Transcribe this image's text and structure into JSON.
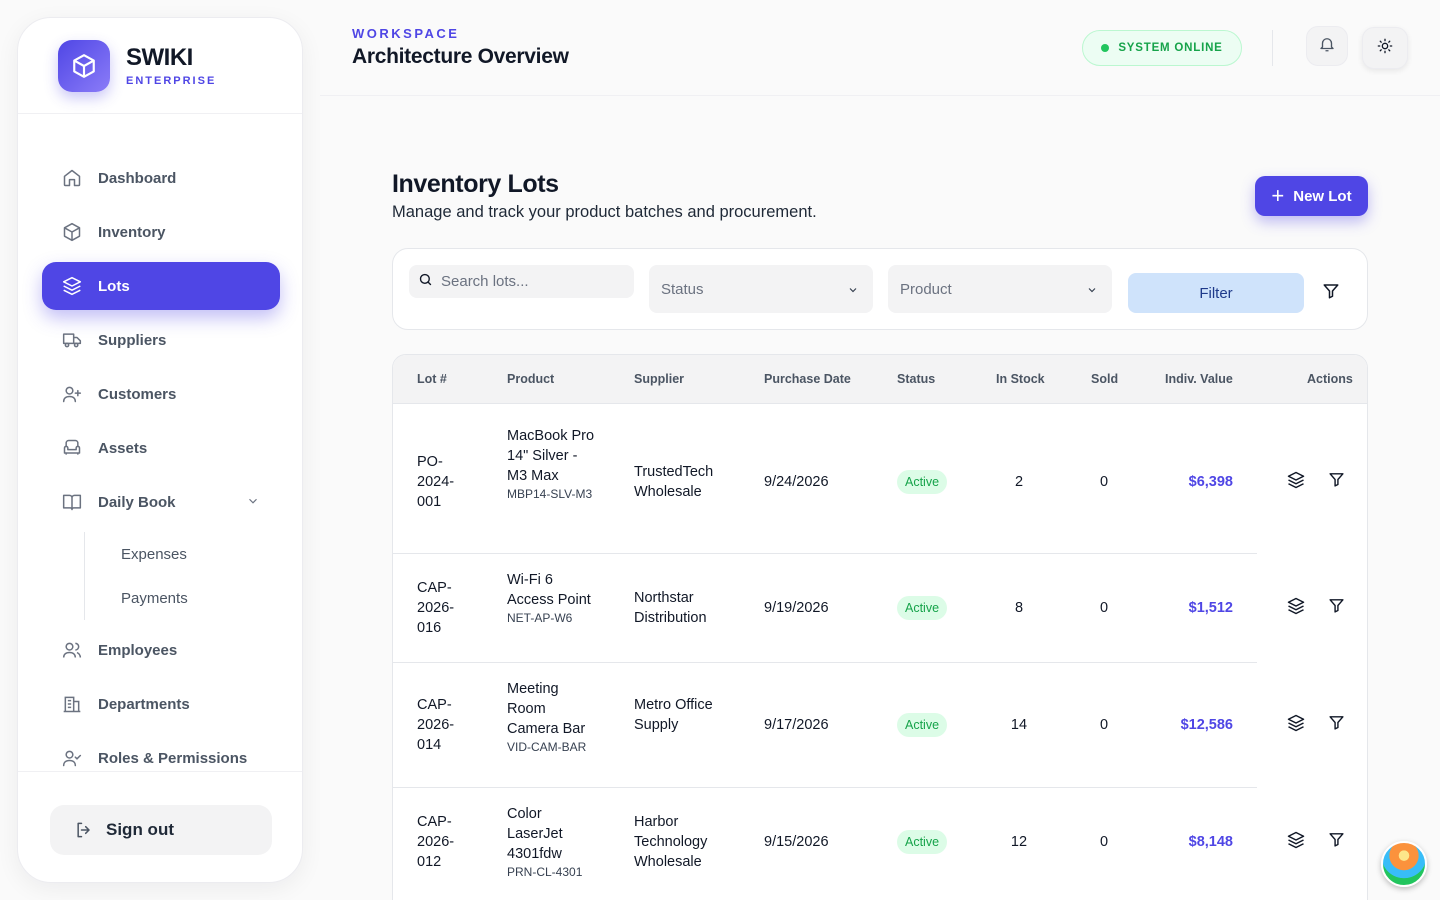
{
  "brand": {
    "name": "SWIKI",
    "subtitle": "ENTERPRISE"
  },
  "sidebar": {
    "items": [
      {
        "label": "Dashboard",
        "icon": "home-icon"
      },
      {
        "label": "Inventory",
        "icon": "box-icon"
      },
      {
        "label": "Lots",
        "icon": "layers-icon",
        "active": true
      },
      {
        "label": "Suppliers",
        "icon": "truck-icon"
      },
      {
        "label": "Customers",
        "icon": "user-plus-icon"
      },
      {
        "label": "Assets",
        "icon": "armchair-icon"
      },
      {
        "label": "Daily Book",
        "icon": "book-icon",
        "expanded": true
      },
      {
        "label": "Employees",
        "icon": "users-icon"
      },
      {
        "label": "Departments",
        "icon": "building-icon"
      },
      {
        "label": "Roles & Permissions",
        "icon": "user-check-icon"
      }
    ],
    "sub_items": [
      "Expenses",
      "Payments"
    ],
    "signout": "Sign out"
  },
  "header": {
    "label": "WORKSPACE",
    "title": "Architecture Overview",
    "status": "SYSTEM ONLINE"
  },
  "page": {
    "title": "Inventory Lots",
    "subtitle": "Manage and track your product batches and procurement.",
    "new_button": "New Lot"
  },
  "filters": {
    "search_placeholder": "Search lots...",
    "status_placeholder": "Status",
    "product_placeholder": "Product",
    "filter_button": "Filter"
  },
  "table": {
    "columns": [
      "Lot #",
      "Product",
      "Supplier",
      "Purchase Date",
      "Status",
      "In Stock",
      "Sold",
      "Indiv. Value",
      "Actions"
    ],
    "rows": [
      {
        "lot": "PO-2024-001",
        "product": "MacBook Pro 14\" Silver - M3 Max",
        "sku": "MBP14-SLV-M3",
        "supplier": "TrustedTech Wholesale",
        "date": "9/24/2026",
        "status": "Active",
        "in_stock": "2",
        "sold": "0",
        "value": "$6,398"
      },
      {
        "lot": "CAP-2026-016",
        "product": "Wi-Fi 6 Access Point",
        "sku": "NET-AP-W6",
        "supplier": "Northstar Distribution",
        "date": "9/19/2026",
        "status": "Active",
        "in_stock": "8",
        "sold": "0",
        "value": "$1,512"
      },
      {
        "lot": "CAP-2026-014",
        "product": "Meeting Room Camera Bar",
        "sku": "VID-CAM-BAR",
        "supplier": "Metro Office Supply",
        "date": "9/17/2026",
        "status": "Active",
        "in_stock": "14",
        "sold": "0",
        "value": "$12,586"
      },
      {
        "lot": "CAP-2026-012",
        "product": "Color LaserJet 4301fdw",
        "sku": "PRN-CL-4301",
        "supplier": "Harbor Technology Wholesale",
        "date": "9/15/2026",
        "status": "Active",
        "in_stock": "12",
        "sold": "0",
        "value": "$8,148"
      }
    ]
  },
  "colors": {
    "accent": "#4f46e5",
    "success": "#16a34a",
    "success_bg": "#dcfce7"
  }
}
